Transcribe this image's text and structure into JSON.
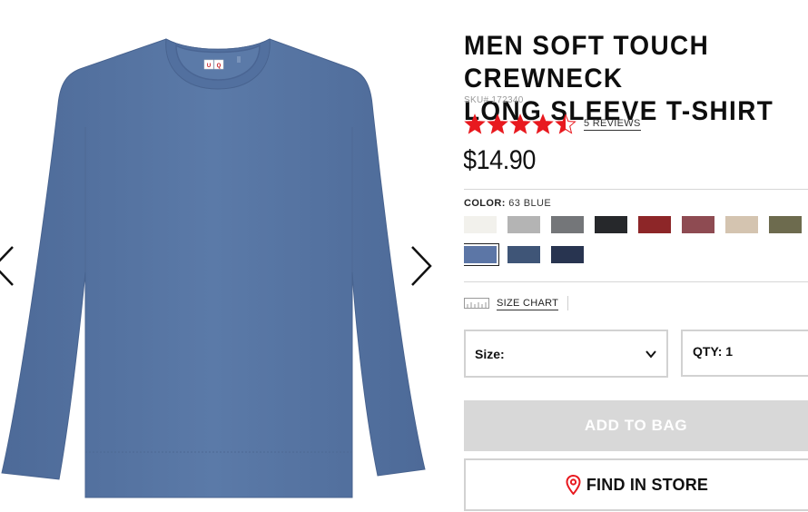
{
  "product": {
    "title": "MEN SOFT TOUCH CREWNECK\nLONG SLEEVE T-SHIRT",
    "sku": "SKU# 172340",
    "rating": 4.5,
    "rating_max": 5,
    "reviews_label": "5 REVIEWS",
    "price": "$14.90",
    "brand_logo_text": "UNI QLO"
  },
  "color": {
    "label": "COLOR:",
    "selected": "63 BLUE",
    "swatches_row1": [
      "#f2f1ec",
      "#b4b4b4",
      "#747679",
      "#26282b",
      "#8d2628",
      "#8e4b52",
      "#d4c4b0",
      "#6d6b4e"
    ],
    "swatches_row2": [
      "#5c76a6",
      "#3f5577",
      "#283450"
    ],
    "selected_index": 8
  },
  "size_chart": {
    "label": "SIZE CHART"
  },
  "size_select": {
    "label": "Size:"
  },
  "qty": {
    "label": "QTY: 1"
  },
  "buttons": {
    "add_to_bag": "ADD TO BAG",
    "find_in_store": "FIND IN STORE"
  },
  "colors": {
    "star": "#e8191f",
    "shirt": "#5b7aa8",
    "pin": "#e8191f",
    "disabled_button": "#d8d8d8"
  },
  "icons": {
    "prev": "chevron-left-icon",
    "next": "chevron-right-icon",
    "star": "star-icon",
    "ruler": "ruler-icon",
    "dropdown": "chevron-down-icon",
    "location": "location-pin-icon"
  }
}
